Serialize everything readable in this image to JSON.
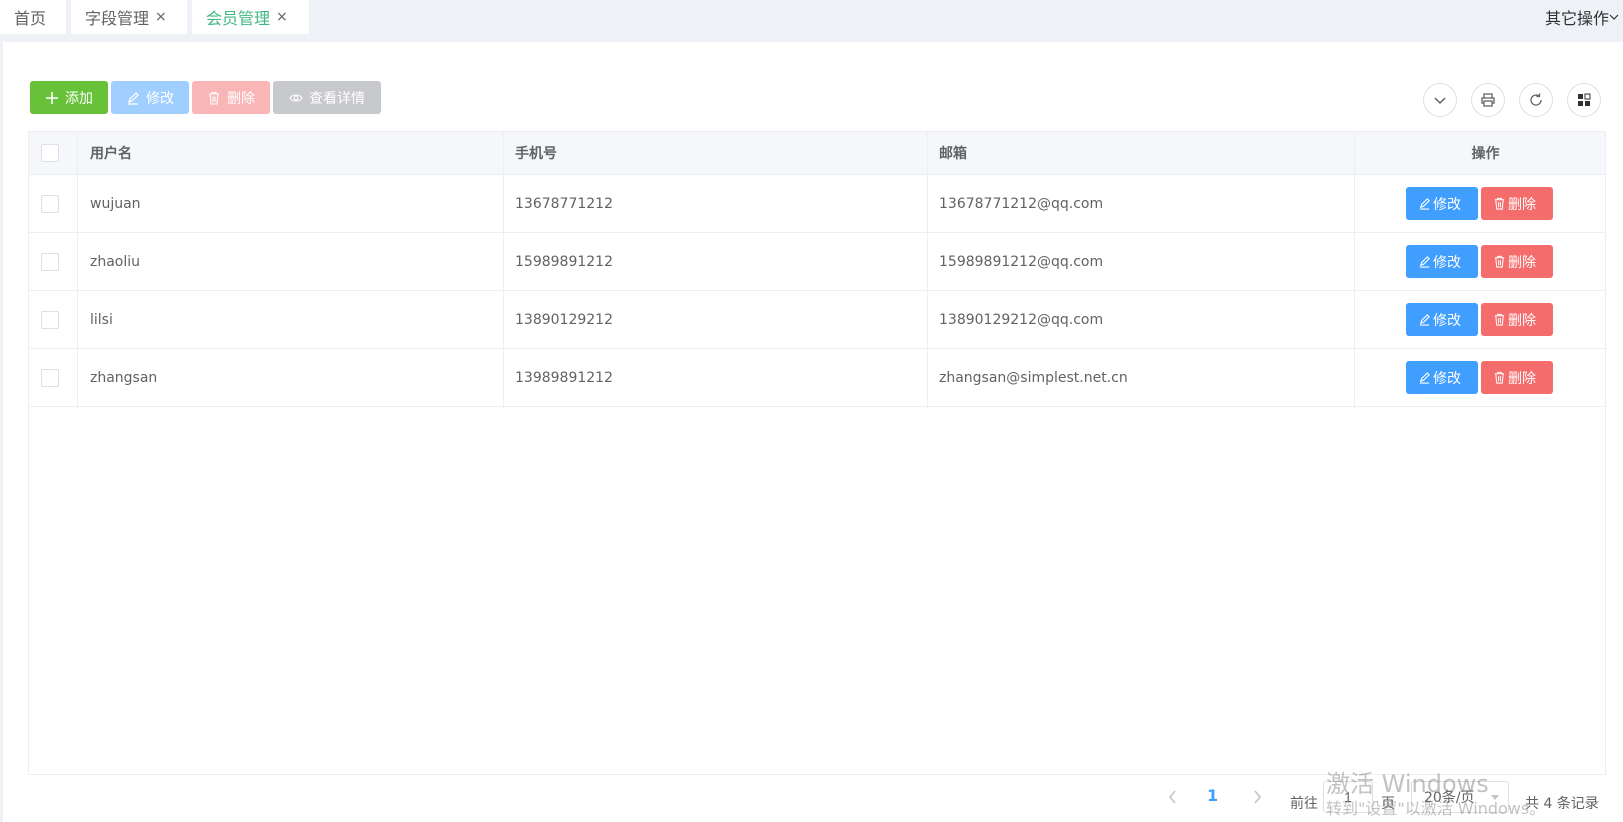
{
  "tabs": [
    {
      "label": "首页",
      "closable": false,
      "active": false
    },
    {
      "label": "字段管理",
      "closable": true,
      "active": false
    },
    {
      "label": "会员管理",
      "closable": true,
      "active": true
    }
  ],
  "tab_close_glyph": "×",
  "other_ops_label": "其它操作",
  "toolbar": {
    "add_label": "添加",
    "edit_label": "修改",
    "delete_label": "删除",
    "view_label": "查看详情"
  },
  "table": {
    "headers": {
      "username": "用户名",
      "phone": "手机号",
      "email": "邮箱",
      "actions": "操作"
    },
    "rows": [
      {
        "username": "wujuan",
        "phone": "13678771212",
        "email": "13678771212@qq.com"
      },
      {
        "username": "zhaoliu",
        "phone": "15989891212",
        "email": "15989891212@qq.com"
      },
      {
        "username": "lilsi",
        "phone": "13890129212",
        "email": "13890129212@qq.com"
      },
      {
        "username": "zhangsan",
        "phone": "13989891212",
        "email": "zhangsan@simplest.net.cn"
      }
    ],
    "row_edit_label": "修改",
    "row_delete_label": "删除"
  },
  "pagination": {
    "current_page": "1",
    "goto_label": "前往",
    "goto_value": "1",
    "page_suffix": "页",
    "page_size": "20条/页",
    "total_text": "共 4 条记录"
  },
  "watermark": {
    "line1": "激活 Windows",
    "line2": "转到\"设置\"以激活 Windows。"
  },
  "colors": {
    "add": "#67c23a",
    "edit": "#409eff",
    "delete": "#f56c6c",
    "active_tab": "#42b983"
  }
}
